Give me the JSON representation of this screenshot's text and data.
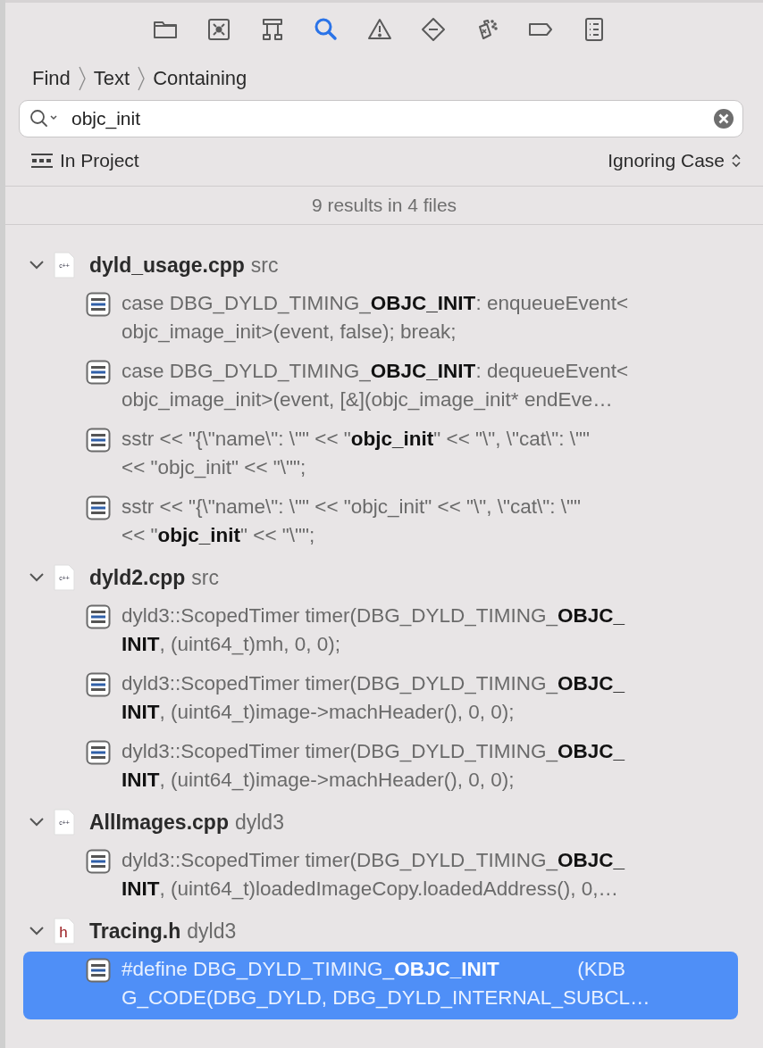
{
  "navigator_tabs": [
    {
      "selected": false
    },
    {
      "selected": false
    },
    {
      "selected": false
    },
    {
      "selected": true
    },
    {
      "selected": false
    },
    {
      "selected": false
    },
    {
      "selected": false
    },
    {
      "selected": false
    },
    {
      "selected": false
    }
  ],
  "breadcrumb": [
    "Find",
    "Text",
    "Containing"
  ],
  "search": {
    "value": "objc_init"
  },
  "scope": {
    "label": "In Project"
  },
  "case_option": {
    "label": "Ignoring Case"
  },
  "summary": "9 results in 4 files",
  "files": [
    {
      "name": "dyld_usage.cpp",
      "folder": "src",
      "kind": "cpp",
      "badge": "c++",
      "expanded": true,
      "results": [
        {
          "lines": [
            "case DBG_DYLD_TIMING_**OBJC_INIT**: enqueueEvent<",
            "objc_image_init>(event, false); break;"
          ],
          "selected": false
        },
        {
          "lines": [
            "case DBG_DYLD_TIMING_**OBJC_INIT**: dequeueEvent<",
            "objc_image_init>(event, [&](objc_image_init* endEve…"
          ],
          "selected": false
        },
        {
          "lines": [
            "sstr << \"{\\\"name\\\": \\\"\" << \"**objc_init**\" << \"\\\", \\\"cat\\\": \\\"\"",
            "<< \"objc_init\" << \"\\\"\";"
          ],
          "selected": false
        },
        {
          "lines": [
            "sstr << \"{\\\"name\\\": \\\"\" << \"objc_init\" << \"\\\", \\\"cat\\\": \\\"\"",
            "<< \"**objc_init**\" << \"\\\"\";"
          ],
          "selected": false
        }
      ]
    },
    {
      "name": "dyld2.cpp",
      "folder": "src",
      "kind": "cpp",
      "badge": "c++",
      "expanded": true,
      "results": [
        {
          "lines": [
            "dyld3::ScopedTimer timer(DBG_DYLD_TIMING_**OBJC_**",
            "**INIT**, (uint64_t)mh, 0, 0);"
          ],
          "selected": false
        },
        {
          "lines": [
            "dyld3::ScopedTimer timer(DBG_DYLD_TIMING_**OBJC_**",
            "**INIT**, (uint64_t)image->machHeader(), 0, 0);"
          ],
          "selected": false
        },
        {
          "lines": [
            "dyld3::ScopedTimer timer(DBG_DYLD_TIMING_**OBJC_**",
            "**INIT**, (uint64_t)image->machHeader(), 0, 0);"
          ],
          "selected": false
        }
      ]
    },
    {
      "name": "AllImages.cpp",
      "folder": "dyld3",
      "kind": "cpp",
      "badge": "c++",
      "expanded": true,
      "results": [
        {
          "lines": [
            "dyld3::ScopedTimer timer(DBG_DYLD_TIMING_**OBJC_**",
            "**INIT**, (uint64_t)loadedImageCopy.loadedAddress(), 0,…"
          ],
          "selected": false
        }
      ]
    },
    {
      "name": "Tracing.h",
      "folder": "dyld3",
      "kind": "h",
      "badge": "h",
      "expanded": true,
      "results": [
        {
          "lines": [
            "#define DBG_DYLD_TIMING_**OBJC_INIT**              (KDB",
            "G_CODE(DBG_DYLD, DBG_DYLD_INTERNAL_SUBCL…"
          ],
          "selected": true
        }
      ]
    }
  ]
}
